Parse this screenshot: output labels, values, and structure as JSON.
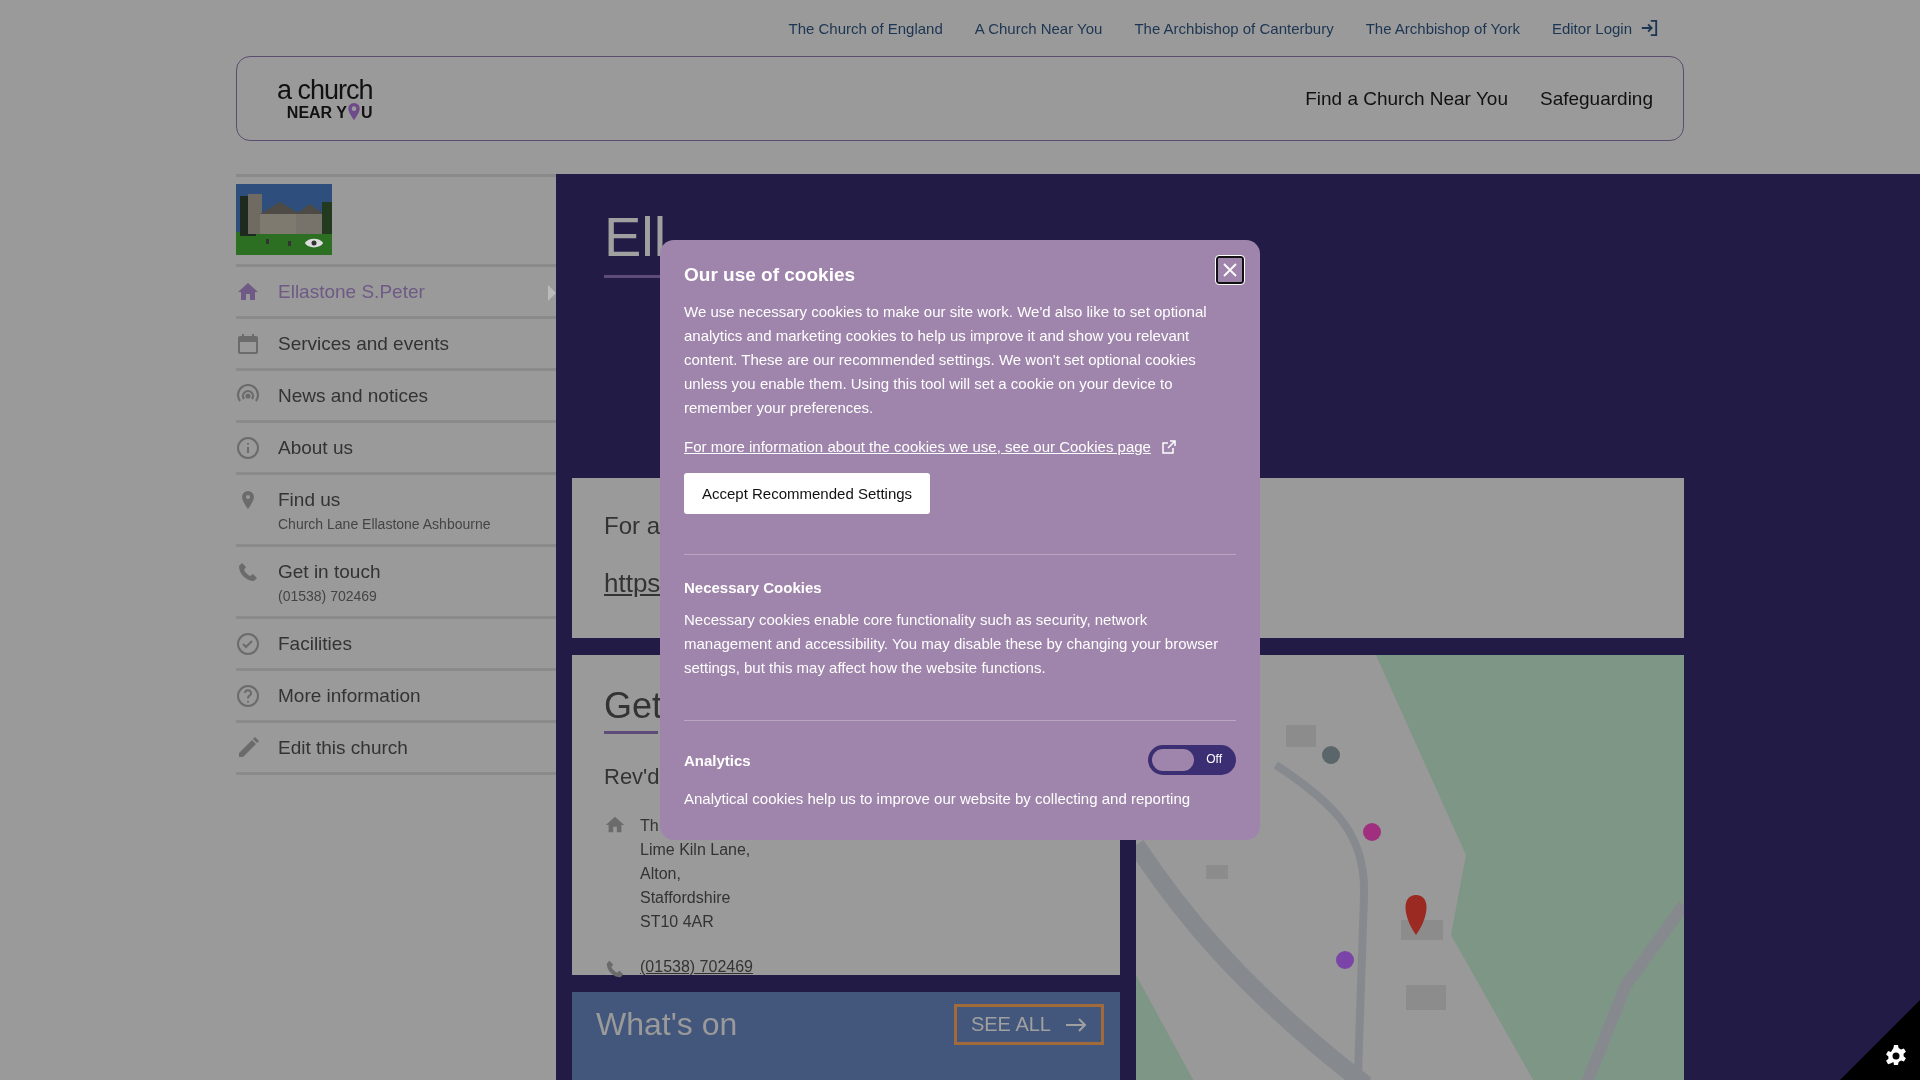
{
  "top_links": [
    {
      "label": "The Church of England"
    },
    {
      "label": "A Church Near You"
    },
    {
      "label": "The Archbishop of Canterbury"
    },
    {
      "label": "The Archbishop of York"
    },
    {
      "label": "Editor Login",
      "kind": "login"
    }
  ],
  "header": {
    "logo": {
      "line1": "a church",
      "line2_start": "NEAR Y",
      "line2_end": "U"
    },
    "nav": [
      {
        "label": "Find a Church Near You"
      },
      {
        "label": "Safeguarding"
      }
    ]
  },
  "sidebar": {
    "items": [
      {
        "label": "Ellastone S.Peter",
        "selected": true
      },
      {
        "label": "Services and events",
        "selected": false
      },
      {
        "label": "News and notices",
        "selected": false
      },
      {
        "label": "About us",
        "selected": false
      },
      {
        "label": "Find us",
        "sub": "Church Lane Ellastone Ashbourne",
        "selected": false
      },
      {
        "label": "Get in touch",
        "sub": "(01538) 702469",
        "selected": false
      },
      {
        "label": "Facilities",
        "selected": false
      },
      {
        "label": "More information",
        "selected": false
      },
      {
        "label": "Edit this church",
        "selected": false
      }
    ]
  },
  "main": {
    "title": "Ell",
    "info_card": {
      "line1": "For a",
      "link": "https"
    },
    "contact_card": {
      "heading": "Get",
      "name": "Rev'd",
      "address": [
        "Th",
        "Lime Kiln Lane,",
        "Alton,",
        "Staffordshire",
        "ST10 4AR"
      ],
      "phone": "(01538) 702469"
    },
    "whats_on": {
      "title": "What's on",
      "button": "SEE ALL"
    }
  },
  "cookie_dialog": {
    "title": "Our use of cookies",
    "intro": "We use necessary cookies to make our site work. We'd also like to set optional analytics and marketing cookies to help us improve it and show you relevant content. These are our recommended settings. We won't set optional cookies unless you enable them. Using this tool will set a cookie on your device to remember your preferences.",
    "link": "For more information about the cookies we use, see our Cookies page",
    "accept_button": "Accept Recommended Settings",
    "sections": [
      {
        "kind": "text",
        "title": "Necessary Cookies",
        "text": "Necessary cookies enable core functionality such as security, network management and accessibility. You may disable these by changing your browser settings, but this may affect how the website functions."
      },
      {
        "kind": "toggle",
        "title": "Analytics",
        "on": false,
        "toggle_label": "Off",
        "text": "Analytical cookies help us to improve our website by collecting and reporting"
      }
    ]
  }
}
